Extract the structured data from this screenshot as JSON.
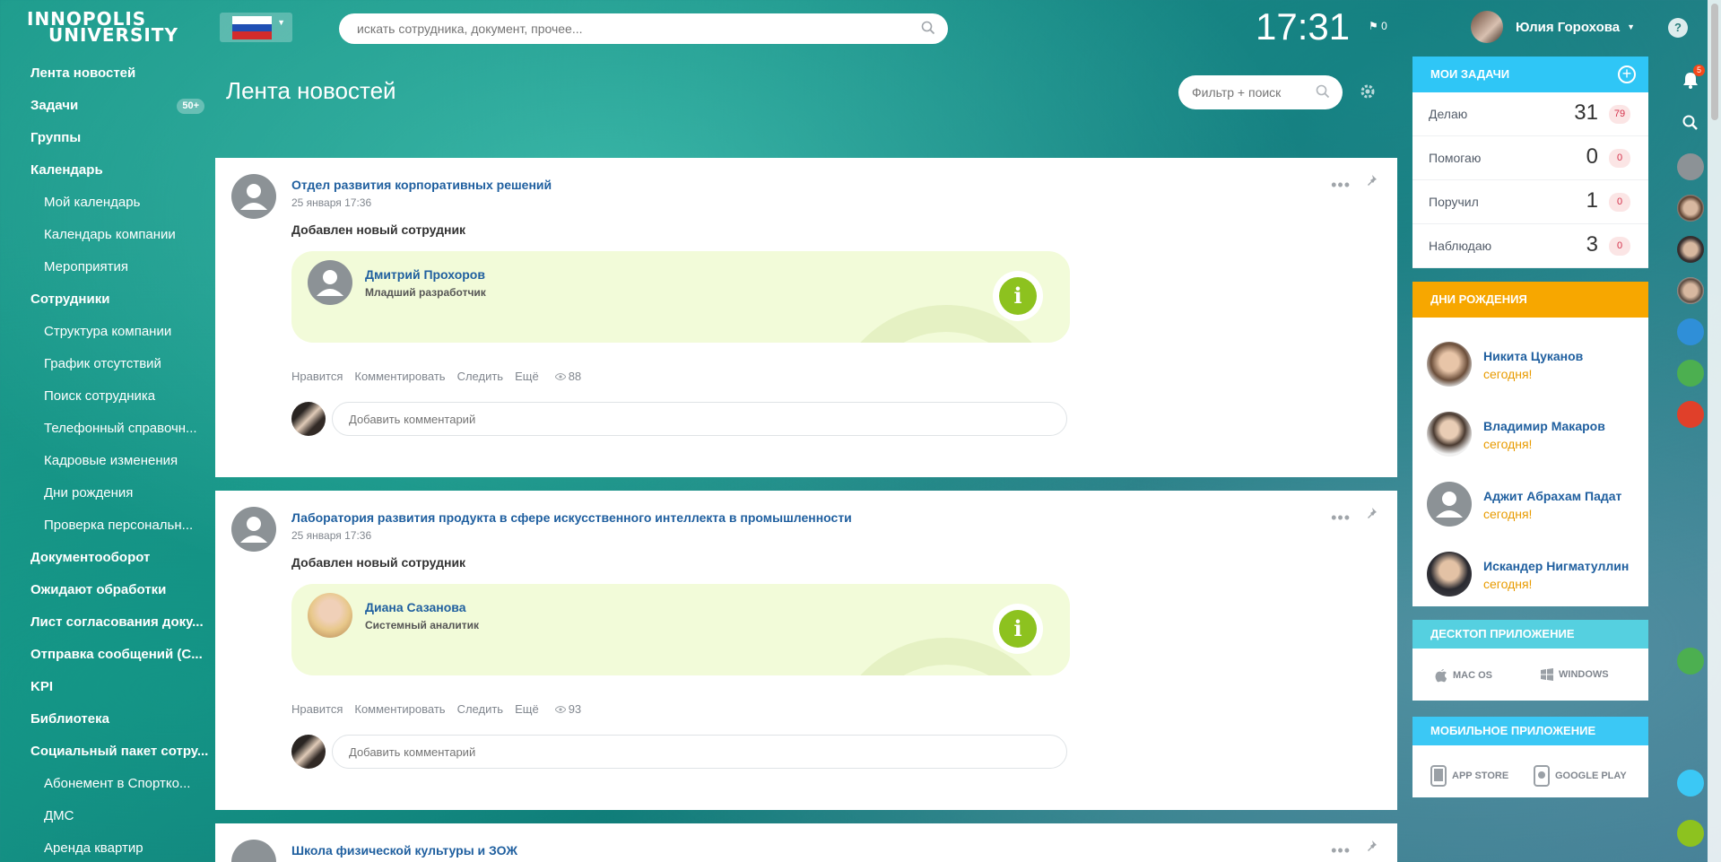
{
  "header": {
    "logo_line1": "INNOPOLIS",
    "logo_line2": "UNIVERSITY",
    "search_placeholder": "искать сотрудника, документ, прочее...",
    "time": "17:31",
    "flag_count": "0",
    "user_name": "Юлия Горохова",
    "help": "?"
  },
  "menu": [
    {
      "label": "Лента новостей",
      "type": "top"
    },
    {
      "label": "Задачи",
      "type": "top",
      "badge": "50+"
    },
    {
      "label": "Группы",
      "type": "top"
    },
    {
      "label": "Календарь",
      "type": "top"
    },
    {
      "label": "Мой календарь",
      "type": "sub"
    },
    {
      "label": "Календарь компании",
      "type": "sub"
    },
    {
      "label": "Мероприятия",
      "type": "sub"
    },
    {
      "label": "Сотрудники",
      "type": "top"
    },
    {
      "label": "Структура компании",
      "type": "sub"
    },
    {
      "label": "График отсутствий",
      "type": "sub"
    },
    {
      "label": "Поиск сотрудника",
      "type": "sub"
    },
    {
      "label": "Телефонный справочн...",
      "type": "sub"
    },
    {
      "label": "Кадровые изменения",
      "type": "sub"
    },
    {
      "label": "Дни рождения",
      "type": "sub"
    },
    {
      "label": "Проверка персональн...",
      "type": "sub"
    },
    {
      "label": "Документооборот",
      "type": "top"
    },
    {
      "label": "Ожидают обработки",
      "type": "top"
    },
    {
      "label": "Лист согласования доку...",
      "type": "top"
    },
    {
      "label": "Отправка сообщений (С...",
      "type": "top"
    },
    {
      "label": "KPI",
      "type": "top"
    },
    {
      "label": "Библиотека",
      "type": "top"
    },
    {
      "label": "Социальный пакет сотру...",
      "type": "top"
    },
    {
      "label": "Абонемент в Спортко...",
      "type": "sub"
    },
    {
      "label": "ДМС",
      "type": "sub"
    },
    {
      "label": "Аренда квартир",
      "type": "sub"
    }
  ],
  "page": {
    "title": "Лента новостей",
    "filter_placeholder": "Фильтр + поиск"
  },
  "posts": [
    {
      "author": "Отдел развития корпоративных решений",
      "date": "25 января 17:36",
      "text": "Добавлен новый сотрудник",
      "employee_name": "Дмитрий Прохоров",
      "employee_position": "Младший разработчик",
      "actions": {
        "like": "Нравится",
        "comment": "Комментировать",
        "follow": "Следить",
        "more": "Ещё"
      },
      "views": "88",
      "comment_placeholder": "Добавить комментарий"
    },
    {
      "author": "Лаборатория развития продукта в сфере искусственного интеллекта в промышленности",
      "date": "25 января 17:36",
      "text": "Добавлен новый сотрудник",
      "employee_name": "Диана Сазанова",
      "employee_position": "Системный аналитик",
      "actions": {
        "like": "Нравится",
        "comment": "Комментировать",
        "follow": "Следить",
        "more": "Ещё"
      },
      "views": "93",
      "comment_placeholder": "Добавить комментарий"
    },
    {
      "author": "Школа физической культуры и ЗОЖ"
    }
  ],
  "tasks": {
    "title": "МОИ ЗАДАЧИ",
    "rows": [
      {
        "label": "Делаю",
        "count": "31",
        "overdue": "79"
      },
      {
        "label": "Помогаю",
        "count": "0",
        "overdue": "0"
      },
      {
        "label": "Поручил",
        "count": "1",
        "overdue": "0"
      },
      {
        "label": "Наблюдаю",
        "count": "3",
        "overdue": "0"
      }
    ]
  },
  "birthdays": {
    "title": "ДНИ РОЖДЕНИЯ",
    "items": [
      {
        "name": "Никита Цуканов",
        "when": "сегодня!"
      },
      {
        "name": "Владимир Макаров",
        "when": "сегодня!"
      },
      {
        "name": "Аджит Абрахам Падат",
        "when": "сегодня!"
      },
      {
        "name": "Искандер Нигматуллин",
        "when": "сегодня!"
      }
    ]
  },
  "desktop_app": {
    "title": "ДЕСКТОП ПРИЛОЖЕНИЕ",
    "mac": "MAC OS",
    "windows": "WINDOWS"
  },
  "mobile_app": {
    "title": "МОБИЛЬНОЕ ПРИЛОЖЕНИЕ",
    "appstore": "APP STORE",
    "googleplay": "GOOGLE PLAY"
  },
  "notifications": {
    "count": "5"
  },
  "colors": {
    "tasks_header": "#2fc6f6",
    "birthdays_header": "#f7a700",
    "desktop_header": "#55d0e0",
    "mobile_header": "#3bc8f5",
    "link": "#1f5f9f",
    "info_green": "#8dc21f",
    "card_bg": "#f2fbd9"
  }
}
